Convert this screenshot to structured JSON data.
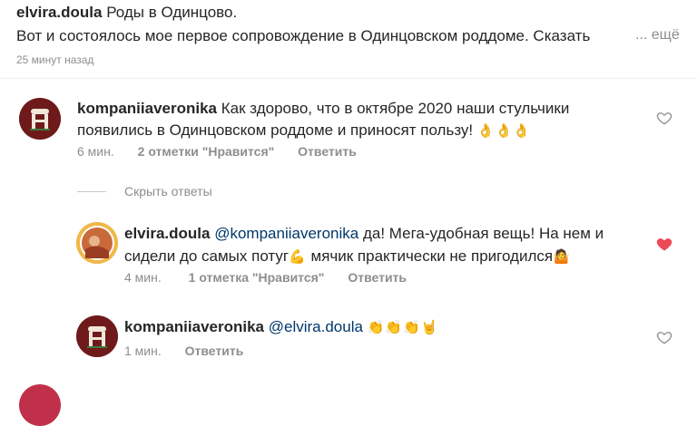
{
  "caption": {
    "username": "elvira.doula",
    "line1": "Роды в Одинцово.",
    "line2": "Вот и состоялось мое первое сопровождение в Одинцовском роддоме. Сказать",
    "more": "... ещё",
    "time": "25 минут назад"
  },
  "comments": [
    {
      "username": "kompaniiaveronika",
      "text_line1": "Как здорово, что в октябре 2020 наши стульчики",
      "text_line2": "появились в Одинцовском роддоме и приносят пользу!",
      "emoji": "👌👌👌",
      "time": "6 мин.",
      "likes": "2 отметки \"Нравится\"",
      "reply": "Ответить",
      "liked": false
    }
  ],
  "hide_replies": "Скрыть ответы",
  "replies": [
    {
      "username": "elvira.doula",
      "mention": "@kompaniiaveronika",
      "text_line1": "да! Мега-удобная вещь! На нем и",
      "text_line2a": "сидели до самых потуг",
      "emoji_a": "💪",
      "text_line2b": "мячик практически не пригодился",
      "emoji_b": "🤷",
      "time": "4 мин.",
      "likes": "1 отметка \"Нравится\"",
      "reply": "Ответить",
      "liked": true
    },
    {
      "username": "kompaniiaveronika",
      "mention": "@elvira.doula",
      "emoji": "👏👏👏🤘",
      "time": "1 мин.",
      "reply": "Ответить",
      "liked": false
    }
  ],
  "colors": {
    "text": "#262626",
    "muted": "#8e8e8e",
    "mention": "#00376b",
    "like_active": "#ed4956"
  }
}
